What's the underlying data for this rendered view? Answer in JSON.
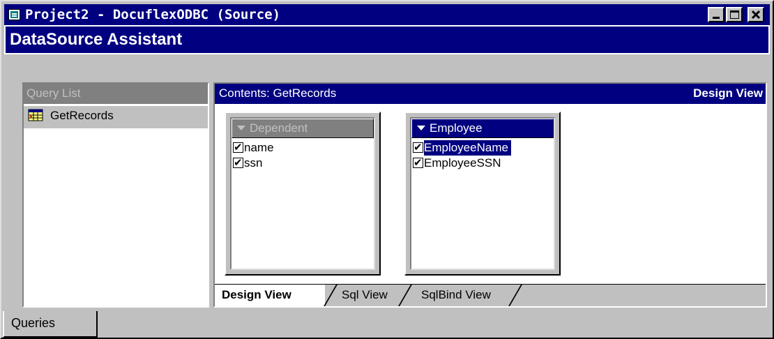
{
  "window": {
    "title": "Project2 - DocuflexODBC (Source)",
    "buttons": {
      "minimize": "minimize-icon",
      "maximize": "maximize-icon",
      "close": "close-icon"
    }
  },
  "assistant": {
    "title": "DataSource Assistant"
  },
  "query_list": {
    "header": "Query List",
    "items": [
      {
        "label": "GetRecords",
        "icon": "query-table-icon"
      }
    ]
  },
  "contents": {
    "title": "Contents: GetRecords",
    "view": "Design View"
  },
  "tables": [
    {
      "name": "Dependent",
      "state": "inactive",
      "fields": [
        {
          "label": "name",
          "checked": true
        },
        {
          "label": "ssn",
          "checked": true
        }
      ]
    },
    {
      "name": "Employee",
      "state": "active",
      "fields": [
        {
          "label": "EmployeeName",
          "checked": true,
          "selected": true
        },
        {
          "label": "EmployeeSSN",
          "checked": true
        }
      ]
    }
  ],
  "view_tabs": [
    {
      "label": "Design View",
      "active": true
    },
    {
      "label": "Sql View",
      "active": false
    },
    {
      "label": "SqlBind View",
      "active": false
    }
  ],
  "bottom_tabs": [
    {
      "label": "Queries",
      "active": true
    }
  ],
  "colors": {
    "titlebar": "#000080",
    "face": "#c0c0c0",
    "selection": "#000080"
  }
}
